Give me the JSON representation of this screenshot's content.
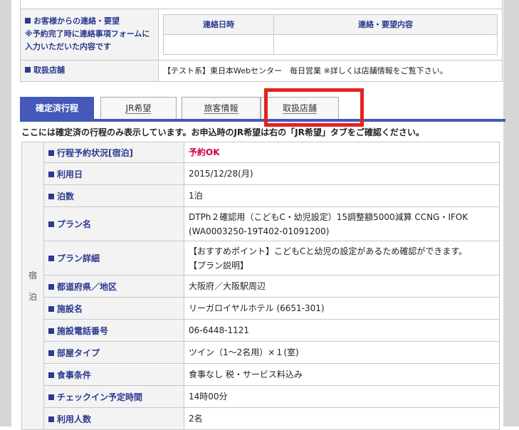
{
  "top": {
    "contact_label_line1": "お客様からの連絡・要望",
    "contact_label_line2": "※予約完了時に連絡事項フォームに",
    "contact_label_line3": "入力いただいた内容です",
    "contact_col1": "連絡日時",
    "contact_col2": "連絡・要望内容",
    "store_label": "取扱店舗",
    "store_value": "【テスト系】東日本Webセンター　毎日営業 ※詳しくは店舗情報をご覧下さい。"
  },
  "tabs": [
    {
      "label": "確定済行程"
    },
    {
      "label": "JR希望"
    },
    {
      "label": "旅客情報"
    },
    {
      "label": "取扱店舗"
    }
  ],
  "note": "ここには確定済の行程のみ表示しています。お申込時のJR希望は右の「JR希望」タブをご確認ください。",
  "detail": {
    "category": "宿泊",
    "rows": [
      {
        "label": "行程予約状況[宿泊]",
        "value": "予約OK"
      },
      {
        "label": "利用日",
        "value": "2015/12/28(月)"
      },
      {
        "label": "泊数",
        "value": "1泊"
      },
      {
        "label": "プラン名",
        "value": "DTPh２確認用（こどもC・幼児設定）15調整額5000減算 CCNG・IFOK",
        "value2": "(WA0003250-19T402-01091200)"
      },
      {
        "label": "プラン詳細",
        "value": "【おすすめポイント】こどもCと幼児の設定があるため確認ができます。",
        "value2": "【プラン説明】"
      },
      {
        "label": "都道府県／地区",
        "value": "大阪府／大阪駅周辺"
      },
      {
        "label": "施設名",
        "value": "リーガロイヤルホテル (6651-301)"
      },
      {
        "label": "施設電話番号",
        "value": "06-6448-1121"
      },
      {
        "label": "部屋タイプ",
        "value": "ツイン（1～2名用）×１(室)"
      },
      {
        "label": "食事条件",
        "value": "食事なし 税・サービス料込み"
      },
      {
        "label": "チェックイン予定時間",
        "value": "14時00分"
      },
      {
        "label": "利用人数",
        "value": "2名"
      }
    ]
  }
}
